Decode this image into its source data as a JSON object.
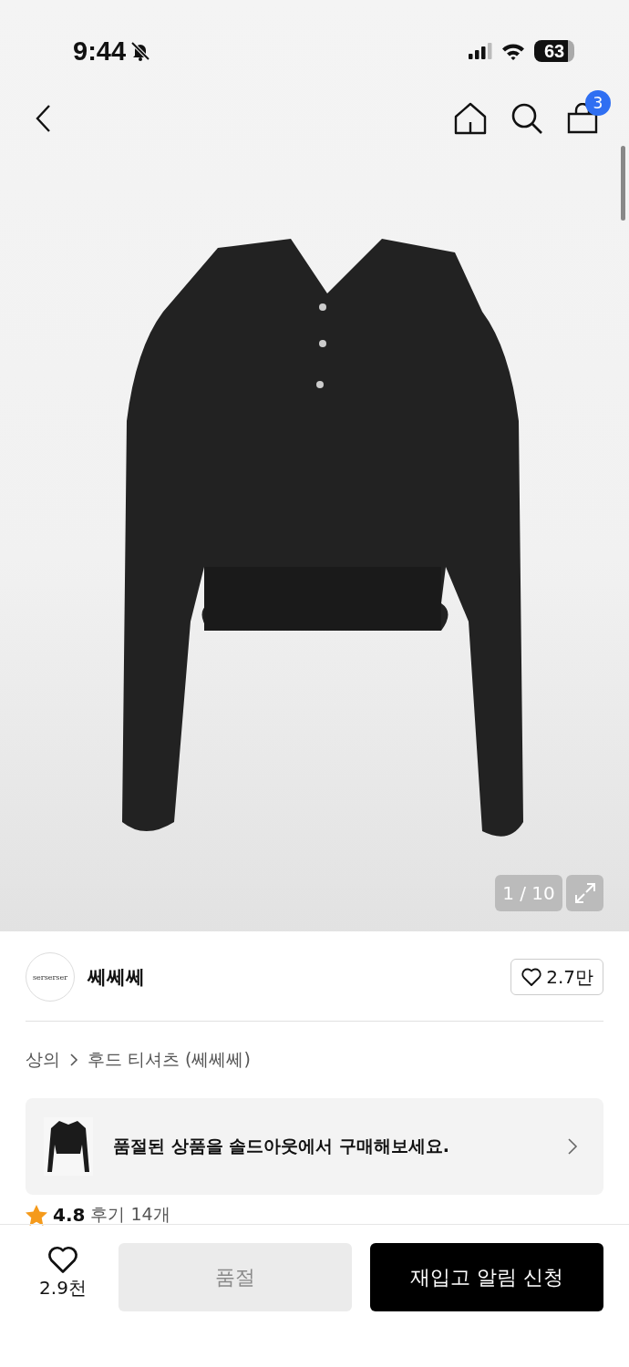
{
  "status_bar": {
    "time": "9:44",
    "silent": true,
    "battery": "63"
  },
  "nav": {
    "cart_count": "3"
  },
  "gallery": {
    "counter": "1 / 10"
  },
  "store": {
    "logo_text": "serserser",
    "name": "쎄쎄쎄",
    "likes": "2.7만",
    "liked": false
  },
  "breadcrumb": [
    {
      "label": "상의"
    },
    {
      "label": "후드 티셔츠 (쎄쎄쎄)"
    }
  ],
  "banner": {
    "text": "품절된 상품을 솔드아웃에서 구매해보세요."
  },
  "rating": {
    "score": "4.8",
    "reviews": "후기 14개"
  },
  "bottom_bar": {
    "likes": "2.9천",
    "liked": false,
    "buttons": [
      {
        "label": "품절",
        "disabled": true
      },
      {
        "label": "재입고 알림 신청",
        "disabled": false
      }
    ]
  }
}
